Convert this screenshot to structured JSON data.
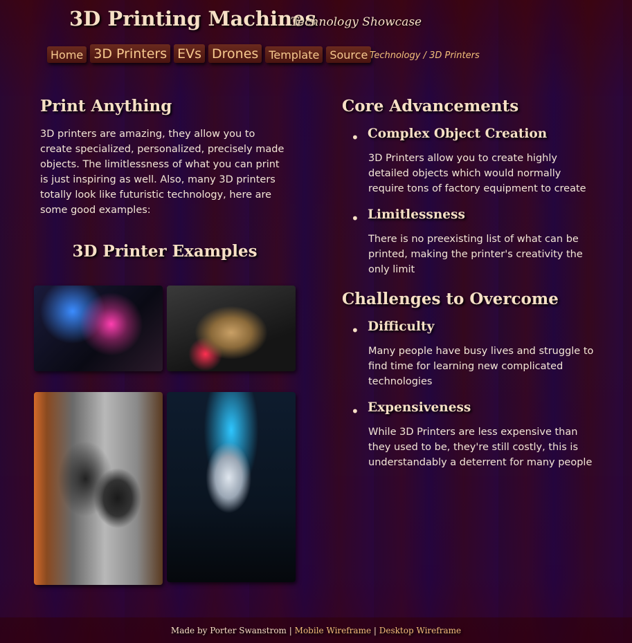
{
  "header": {
    "title": "3D Printing Machines",
    "subtitle": "Technology Showcase"
  },
  "nav": [
    {
      "label": "Home",
      "size": "small"
    },
    {
      "label": "3D Printers",
      "size": "big"
    },
    {
      "label": "EVs",
      "size": "big"
    },
    {
      "label": "Drones",
      "size": "big"
    },
    {
      "label": "Template",
      "size": "small"
    },
    {
      "label": "Source",
      "size": "small"
    }
  ],
  "breadcrumb": "Technology / 3D Printers",
  "intro": {
    "heading": "Print Anything",
    "text": "3D printers are amazing, they allow you to create specialized, personalized, precisely made objects. The limitlessness of what you can print is just inspiring as well. Also, many 3D printers totally look like futuristic technology, here are some good examples:"
  },
  "examples": {
    "heading": "3D Printer Examples"
  },
  "advancements": {
    "heading": "Core Advancements",
    "items": [
      {
        "title": "Complex Object Creation",
        "text": "3D Printers allow you to create highly detailed objects which would normally require tons of factory equipment to create"
      },
      {
        "title": "Limitlessness",
        "text": "There is no preexisting list of what can be printed, making the printer's creativity the only limit"
      }
    ]
  },
  "challenges": {
    "heading": "Challenges to Overcome",
    "items": [
      {
        "title": "Difficulty",
        "text": "Many people have busy lives and struggle to find time for learning new complicated technologies"
      },
      {
        "title": "Expensiveness",
        "text": "While 3D Printers are less expensive than they used to be, they're still costly, this is understandably a deterrent for many people"
      }
    ]
  },
  "footer": {
    "credit": "Made by Porter Swanstrom",
    "sep": "|",
    "mobile_link": "Mobile Wireframe",
    "desktop_link": "Desktop Wireframe"
  }
}
